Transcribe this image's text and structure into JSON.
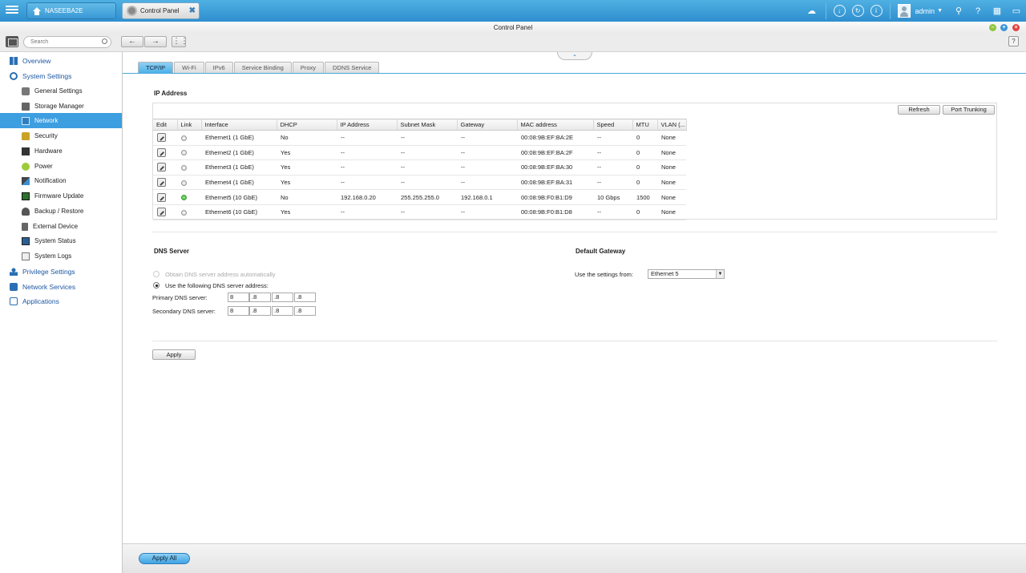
{
  "topbar": {
    "home_tab": "NASEEBA2E",
    "app_tab": "Control Panel",
    "app_tab_close": "✖",
    "user": "admin",
    "icons": [
      "cloud-icon",
      "download-icon",
      "sync-icon",
      "info-icon",
      "user-icon",
      "search-icon",
      "help-icon",
      "apps-icon",
      "monitor-icon"
    ]
  },
  "window": {
    "title": "Control Panel"
  },
  "toolbar": {
    "search_placeholder": "Search",
    "back": "←",
    "forward": "→",
    "help": "?"
  },
  "sidebar": {
    "overview": "Overview",
    "system_settings": "System Settings",
    "items": [
      {
        "label": "General Settings",
        "icon": "general-settings-icon"
      },
      {
        "label": "Storage Manager",
        "icon": "storage-icon"
      },
      {
        "label": "Network",
        "icon": "network-icon"
      },
      {
        "label": "Security",
        "icon": "lock-icon"
      },
      {
        "label": "Hardware",
        "icon": "hardware-icon"
      },
      {
        "label": "Power",
        "icon": "power-icon"
      },
      {
        "label": "Notification",
        "icon": "notification-icon"
      },
      {
        "label": "Firmware Update",
        "icon": "firmware-icon"
      },
      {
        "label": "Backup / Restore",
        "icon": "backup-icon"
      },
      {
        "label": "External Device",
        "icon": "external-device-icon"
      },
      {
        "label": "System Status",
        "icon": "system-status-icon"
      },
      {
        "label": "System Logs",
        "icon": "system-logs-icon"
      }
    ],
    "privilege": "Privilege Settings",
    "network_services": "Network Services",
    "applications": "Applications",
    "selected": "Network"
  },
  "tabs": [
    "TCP/IP",
    "Wi-Fi",
    "IPv6",
    "Service Binding",
    "Proxy",
    "DDNS Service"
  ],
  "active_tab": "TCP/IP",
  "ip_address": {
    "title": "IP Address",
    "refresh": "Refresh",
    "port_trunking": "Port Trunking",
    "columns": [
      "Edit",
      "Link",
      "Interface",
      "DHCP",
      "IP Address",
      "Subnet Mask",
      "Gateway",
      "MAC address",
      "Speed",
      "MTU",
      "VLAN (..."
    ],
    "rows": [
      {
        "link": "off",
        "interface": "Ethernet1 (1 GbE)",
        "dhcp": "No",
        "ip": "--",
        "mask": "--",
        "gateway": "--",
        "mac": "00:08:9B:EF:BA:2E",
        "speed": "--",
        "mtu": "0",
        "vlan": "None"
      },
      {
        "link": "off",
        "interface": "Ethernet2 (1 GbE)",
        "dhcp": "Yes",
        "ip": "--",
        "mask": "--",
        "gateway": "--",
        "mac": "00:08:9B:EF:BA:2F",
        "speed": "--",
        "mtu": "0",
        "vlan": "None"
      },
      {
        "link": "off",
        "interface": "Ethernet3 (1 GbE)",
        "dhcp": "Yes",
        "ip": "--",
        "mask": "--",
        "gateway": "--",
        "mac": "00:08:9B:EF:BA:30",
        "speed": "--",
        "mtu": "0",
        "vlan": "None"
      },
      {
        "link": "off",
        "interface": "Ethernet4 (1 GbE)",
        "dhcp": "Yes",
        "ip": "--",
        "mask": "--",
        "gateway": "--",
        "mac": "00:08:9B:EF:BA:31",
        "speed": "--",
        "mtu": "0",
        "vlan": "None"
      },
      {
        "link": "on",
        "interface": "Ethernet5 (10 GbE)",
        "dhcp": "No",
        "ip": "192.168.0.20",
        "mask": "255.255.255.0",
        "gateway": "192.168.0.1",
        "mac": "00:08:9B:F0:B1:D9",
        "speed": "10 Gbps",
        "mtu": "1500",
        "vlan": "None"
      },
      {
        "link": "off",
        "interface": "Ethernet6 (10 GbE)",
        "dhcp": "Yes",
        "ip": "--",
        "mask": "--",
        "gateway": "--",
        "mac": "00:08:9B:F0:B1:D8",
        "speed": "--",
        "mtu": "0",
        "vlan": "None"
      }
    ]
  },
  "dns": {
    "title": "DNS Server",
    "auto_label": "Obtain DNS server address automatically",
    "manual_label": "Use the following DNS server address:",
    "selected": "manual",
    "primary_label": "Primary DNS server:",
    "secondary_label": "Secondary DNS server:",
    "primary": [
      "8",
      ".8",
      ".8",
      ".8"
    ],
    "secondary": [
      "8",
      ".8",
      ".8",
      ".8"
    ]
  },
  "gateway": {
    "title": "Default Gateway",
    "label": "Use the settings from:",
    "value": "Ethernet 5"
  },
  "apply": "Apply",
  "apply_all": "Apply All",
  "colors": {
    "accent": "#3d9ee0",
    "topbar": "#3a9ad6",
    "link_on": "#2fa82f",
    "nav_text": "#1d57a3"
  }
}
